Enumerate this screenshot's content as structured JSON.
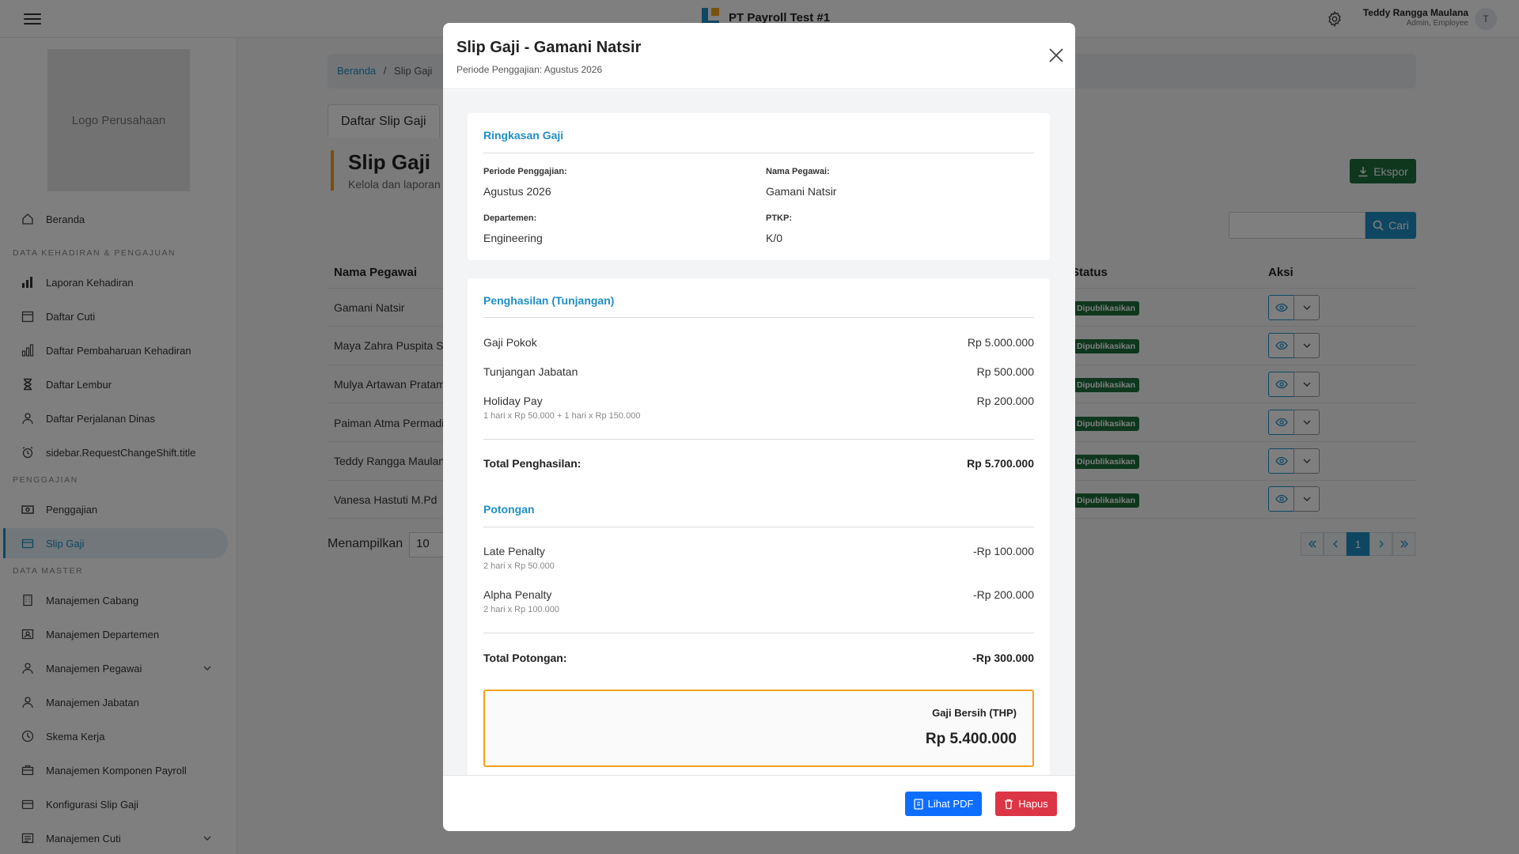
{
  "header": {
    "app_title": "PT Payroll Test #1",
    "user_name": "Teddy Rangga Maulana",
    "user_role": "Admin, Employee",
    "avatar_initial": "T"
  },
  "sidebar": {
    "logo_text": "Logo Perusahaan",
    "home": "Beranda",
    "section_attendance": "DATA KEHADIRAN & PENGAJUAN",
    "attendance_items": [
      "Laporan Kehadiran",
      "Daftar Cuti",
      "Daftar Pembaharuan Kehadiran",
      "Daftar Lembur",
      "Daftar Perjalanan Dinas",
      "sidebar.RequestChangeShift.title"
    ],
    "section_payroll": "PENGGAJIAN",
    "payroll_items": [
      "Penggajian",
      "Slip Gaji"
    ],
    "section_master": "DATA MASTER",
    "master_items": [
      "Manajemen Cabang",
      "Manajemen Departemen",
      "Manajemen Pegawai",
      "Manajemen Jabatan",
      "Skema Kerja",
      "Manajemen Komponen Payroll",
      "Konfigurasi Slip Gaji",
      "Manajemen Cuti"
    ]
  },
  "main": {
    "breadcrumb_home": "Beranda",
    "breadcrumb_sep": "/",
    "breadcrumb_current": "Slip Gaji",
    "tab": "Daftar Slip Gaji",
    "page_title": "Slip Gaji",
    "page_subtitle": "Kelola dan laporan p",
    "export_label": "Ekspor",
    "search_label": "Cari",
    "col_name": "Nama Pegawai",
    "col_status": "Status",
    "col_action": "Aksi",
    "rows": [
      {
        "name": "Gamani Natsir",
        "status": "Dipublikasikan"
      },
      {
        "name": "Maya Zahra Puspita S.",
        "status": "Dipublikasikan"
      },
      {
        "name": "Mulya Artawan Pratam",
        "status": "Dipublikasikan"
      },
      {
        "name": "Paiman Atma Permadi",
        "status": "Dipublikasikan"
      },
      {
        "name": "Teddy Rangga Maulan",
        "status": "Dipublikasikan"
      },
      {
        "name": "Vanesa Hastuti M.Pd",
        "status": "Dipublikasikan"
      }
    ],
    "show_label": "Menampilkan",
    "page_size": "10",
    "current_page": "1"
  },
  "modal": {
    "title": "Slip Gaji - Gamani Natsir",
    "subtitle": "Periode Penggajian: Agustus 2026",
    "summary": {
      "title": "Ringkasan Gaji",
      "period_label": "Periode Penggajian:",
      "period_value": "Agustus 2026",
      "employee_label": "Nama Pegawai:",
      "employee_value": "Gamani Natsir",
      "dept_label": "Departemen:",
      "dept_value": "Engineering",
      "ptkp_label": "PTKP:",
      "ptkp_value": "K/0"
    },
    "earnings": {
      "title": "Penghasilan (Tunjangan)",
      "items": [
        {
          "name": "Gaji Pokok",
          "amount": "Rp 5.000.000",
          "note": ""
        },
        {
          "name": "Tunjangan Jabatan",
          "amount": "Rp 500.000",
          "note": ""
        },
        {
          "name": "Holiday Pay",
          "amount": "Rp 200.000",
          "note": "1 hari x Rp 50.000 + 1 hari x Rp 150.000"
        }
      ],
      "total_label": "Total Penghasilan:",
      "total_amount": "Rp 5.700.000"
    },
    "deductions": {
      "title": "Potongan",
      "items": [
        {
          "name": "Late Penalty",
          "amount": "-Rp 100.000",
          "note": "2 hari x Rp 50.000"
        },
        {
          "name": "Alpha Penalty",
          "amount": "-Rp 200.000",
          "note": "2 hari x Rp 100.000"
        }
      ],
      "total_label": "Total Potongan:",
      "total_amount": "-Rp 300.000"
    },
    "net": {
      "label": "Gaji Bersih (THP)",
      "amount": "Rp 5.400.000"
    },
    "buttons": {
      "pdf": "Lihat PDF",
      "delete": "Hapus"
    }
  },
  "colors": {
    "accent": "#1f8fc4",
    "brand_orange": "#f0a31b",
    "success": "#1c6e3d",
    "primary_button": "#0d6efd",
    "danger_button": "#dc3545"
  }
}
